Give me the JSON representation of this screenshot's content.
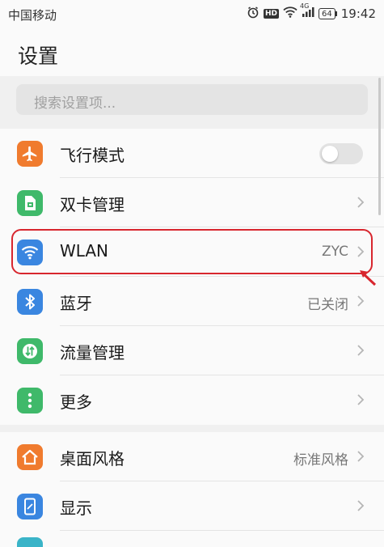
{
  "status_bar": {
    "carrier": "中国移动",
    "hd": "HD",
    "network": "4G",
    "battery": "64",
    "time": "19:42"
  },
  "header": {
    "title": "设置"
  },
  "search": {
    "placeholder": "搜索设置项..."
  },
  "section1": {
    "items": [
      {
        "label": "飞行模式",
        "icon": "airplane-icon",
        "color": "#f07b2e",
        "control": "toggle",
        "on": false
      },
      {
        "label": "双卡管理",
        "icon": "sim-card-icon",
        "color": "#3fb96a"
      },
      {
        "label": "WLAN",
        "value": "ZYC",
        "icon": "wifi-icon",
        "color": "#3a86e0"
      },
      {
        "label": "蓝牙",
        "value": "已关闭",
        "icon": "bluetooth-icon",
        "color": "#3a86e0"
      },
      {
        "label": "流量管理",
        "icon": "data-usage-icon",
        "color": "#3fb96a"
      },
      {
        "label": "更多",
        "icon": "more-icon",
        "color": "#3fb96a"
      }
    ]
  },
  "section2": {
    "items": [
      {
        "label": "桌面风格",
        "value": "标准风格",
        "icon": "home-icon",
        "color": "#f07b2e"
      },
      {
        "label": "显示",
        "icon": "display-icon",
        "color": "#3a86e0"
      }
    ]
  },
  "annotation": {
    "color": "#d8262e"
  }
}
